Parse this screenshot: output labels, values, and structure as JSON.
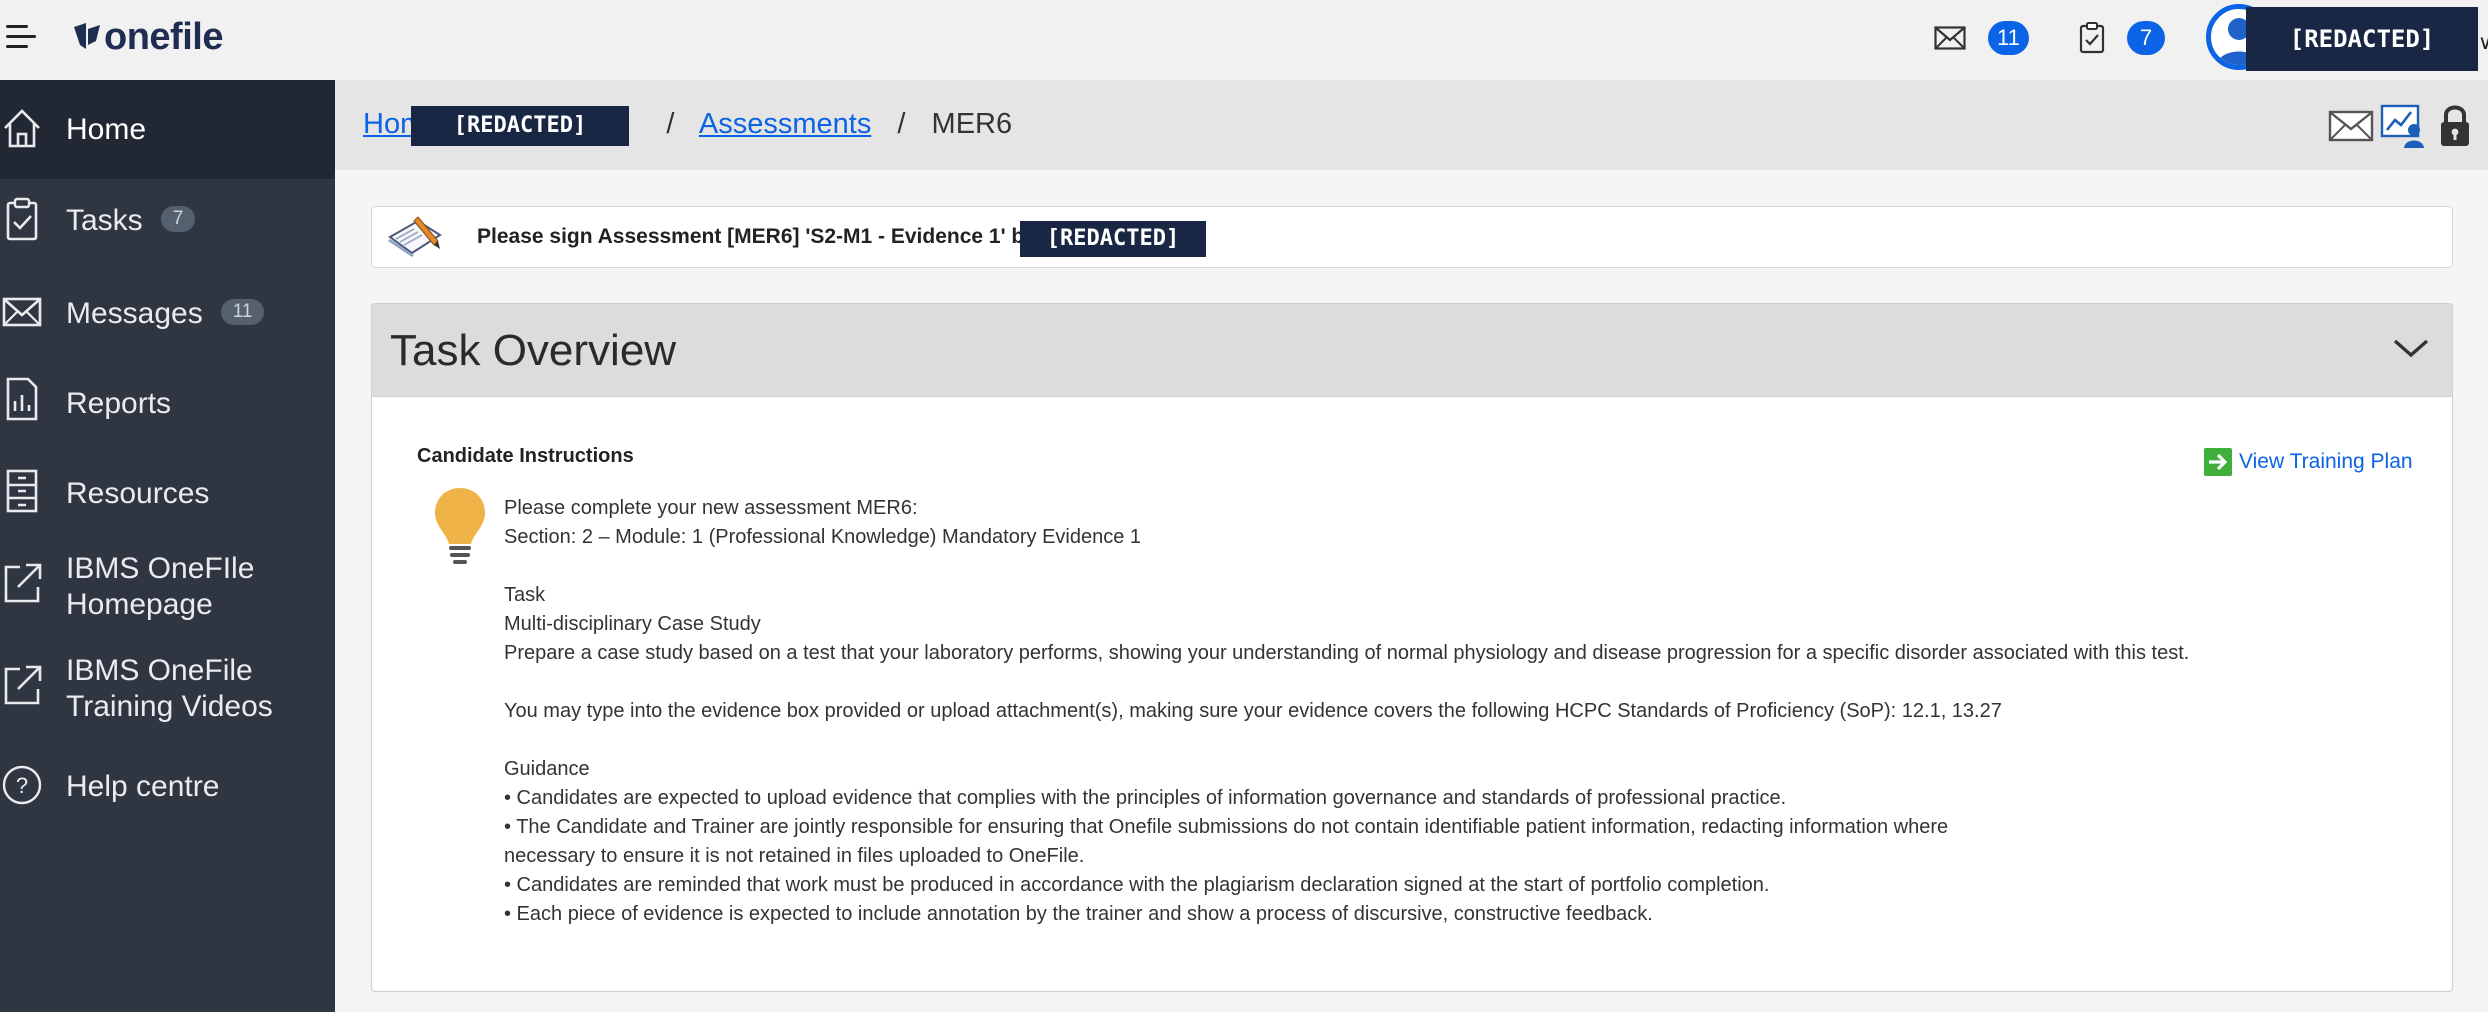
{
  "header": {
    "logo_text": "onefile",
    "messages_count": "11",
    "tasks_count": "7",
    "user_name": "[REDACTED]"
  },
  "sidebar": {
    "items": [
      {
        "label": "Home",
        "icon": "home-icon",
        "active": true
      },
      {
        "label": "Tasks",
        "icon": "clipboard-icon",
        "count": "7"
      },
      {
        "label": "Messages",
        "icon": "envelope-icon",
        "count": "11"
      },
      {
        "label": "Reports",
        "icon": "report-icon"
      },
      {
        "label": "Resources",
        "icon": "cabinet-icon"
      },
      {
        "label": "IBMS OneFIle",
        "label2": "Homepage",
        "icon": "external-link-icon"
      },
      {
        "label": "IBMS OneFile",
        "label2": "Training Videos",
        "icon": "external-link-icon"
      },
      {
        "label": "Help centre",
        "icon": "help-icon"
      }
    ]
  },
  "breadcrumb": {
    "home": "Hom",
    "redacted": "[REDACTED]",
    "assessments": "Assessments",
    "current": "MER6",
    "separator": "/"
  },
  "notification": {
    "text": "Please sign Assessment [MER6] 'S2-M1 - Evidence 1' by",
    "redacted": "[REDACTED]"
  },
  "task_overview": {
    "title": "Task Overview",
    "candidate_heading": "Candidate Instructions",
    "view_training_plan": "View Training Plan",
    "lines": [
      "Please complete your new assessment MER6:",
      "Section: 2 – Module: 1 (Professional Knowledge) Mandatory Evidence 1",
      "",
      "Task",
      "Multi-disciplinary Case Study",
      "Prepare a case study based on a test that your laboratory performs, showing your understanding of normal physiology and disease progression for a specific disorder associated with this test.",
      "",
      "You may type into the evidence box provided or upload attachment(s), making sure your evidence covers the following HCPC Standards of Proficiency (SoP): 12.1, 13.27",
      "",
      "Guidance",
      "• Candidates are expected to upload evidence that complies with the principles of information governance and standards of professional practice.",
      "• The Candidate and Trainer are jointly responsible for ensuring that Onefile submissions do not contain identifiable patient information, redacting information where",
      "necessary to ensure it is not retained in files uploaded to OneFile.",
      "• Candidates are reminded that work must be produced in accordance with the plagiarism declaration signed at the start of portfolio completion.",
      "• Each piece of evidence is expected to include annotation by the trainer and show a process of discursive, constructive feedback."
    ]
  },
  "colors": {
    "sidebar_bg": "#2f3541",
    "sidebar_active": "#222833",
    "accent_blue": "#0b63e5",
    "redaction": "#1a2744",
    "logo_navy": "#1f2d52"
  }
}
